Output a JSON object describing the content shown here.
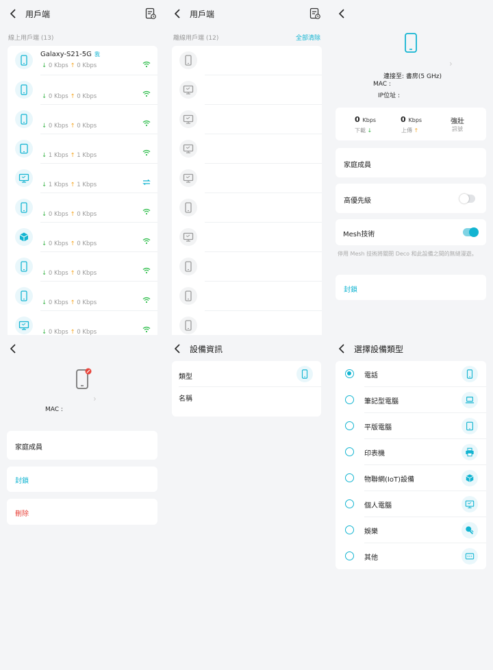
{
  "colors": {
    "accent": "#12b4d1",
    "down": "#3bb54a",
    "up": "#f5a623",
    "danger": "#e8453c"
  },
  "panel_online": {
    "title": "用戶端",
    "section_label": "線上用戶端 (13)",
    "me_badge": "我",
    "clients": [
      {
        "icon": "phone-icon",
        "name": "Galaxy-S21-5G",
        "down": "0 Kbps",
        "up": "0 Kbps",
        "conn": "wifi-icon"
      },
      {
        "icon": "phone-icon",
        "name": "",
        "down": "0 Kbps",
        "up": "0 Kbps",
        "conn": "wifi-icon"
      },
      {
        "icon": "phone-icon",
        "name": "",
        "down": "0 Kbps",
        "up": "0 Kbps",
        "conn": "wifi-icon"
      },
      {
        "icon": "tablet-icon",
        "name": "",
        "down": "1 Kbps",
        "up": "1 Kbps",
        "conn": "wifi-icon"
      },
      {
        "icon": "monitor-icon",
        "name": "",
        "down": "1 Kbps",
        "up": "1 Kbps",
        "conn": "ethernet-icon"
      },
      {
        "icon": "phone-icon",
        "name": "",
        "down": "0 Kbps",
        "up": "0 Kbps",
        "conn": "wifi-icon"
      },
      {
        "icon": "iot-cube-icon",
        "name": "",
        "down": "0 Kbps",
        "up": "0 Kbps",
        "conn": "wifi-icon"
      },
      {
        "icon": "phone-icon",
        "name": "",
        "down": "0 Kbps",
        "up": "0 Kbps",
        "conn": "wifi-icon"
      },
      {
        "icon": "phone-icon",
        "name": "",
        "down": "0 Kbps",
        "up": "0 Kbps",
        "conn": "wifi-icon"
      },
      {
        "icon": "monitor-icon",
        "name": "",
        "down": "0 Kbps",
        "up": "0 Kbps",
        "conn": "wifi-icon"
      }
    ]
  },
  "panel_offline": {
    "title": "用戶端",
    "section_label": "離線用戶端 (12)",
    "clear_all": "全部清除",
    "clients": [
      "phone-icon",
      "monitor-icon",
      "monitor-icon",
      "monitor-icon",
      "monitor-icon",
      "phone-icon",
      "monitor-icon",
      "phone-icon",
      "phone-icon",
      "phone-icon"
    ]
  },
  "panel_detail": {
    "connected_to": "連接至: 書房(5 GHz)",
    "mac_label": "MAC :",
    "ip_label": "IP位址 :",
    "download_value": "0",
    "download_unit": "Kbps",
    "download_label": "下載",
    "upload_value": "0",
    "upload_unit": "Kbps",
    "upload_label": "上傳",
    "signal_value": "強壯",
    "signal_label": "訊號",
    "family_label": "家庭成員",
    "priority_label": "高優先級",
    "priority_on": false,
    "mesh_label": "Mesh技術",
    "mesh_on": true,
    "mesh_note": "停用 Mesh 技術將關閉 Deco 和此設備之間的無縫漫遊。",
    "block_label": "封鎖"
  },
  "panel_offline_detail": {
    "mac_label": "MAC :",
    "family_label": "家庭成員",
    "block_label": "封鎖",
    "delete_label": "刪除"
  },
  "panel_info": {
    "title": "設備資訊",
    "type_label": "類型",
    "name_label": "名稱"
  },
  "panel_types": {
    "title": "選擇設備類型",
    "selected_index": 0,
    "types": [
      {
        "label": "電話",
        "icon": "phone-icon"
      },
      {
        "label": "筆記型電腦",
        "icon": "laptop-icon"
      },
      {
        "label": "平版電腦",
        "icon": "tablet-icon"
      },
      {
        "label": "印表機",
        "icon": "printer-icon"
      },
      {
        "label": "物聯網(IoT)設備",
        "icon": "iot-cube-icon"
      },
      {
        "label": "個人電腦",
        "icon": "monitor-icon"
      },
      {
        "label": "娛樂",
        "icon": "gamepad-icon"
      },
      {
        "label": "其他",
        "icon": "other-device-icon"
      }
    ]
  }
}
